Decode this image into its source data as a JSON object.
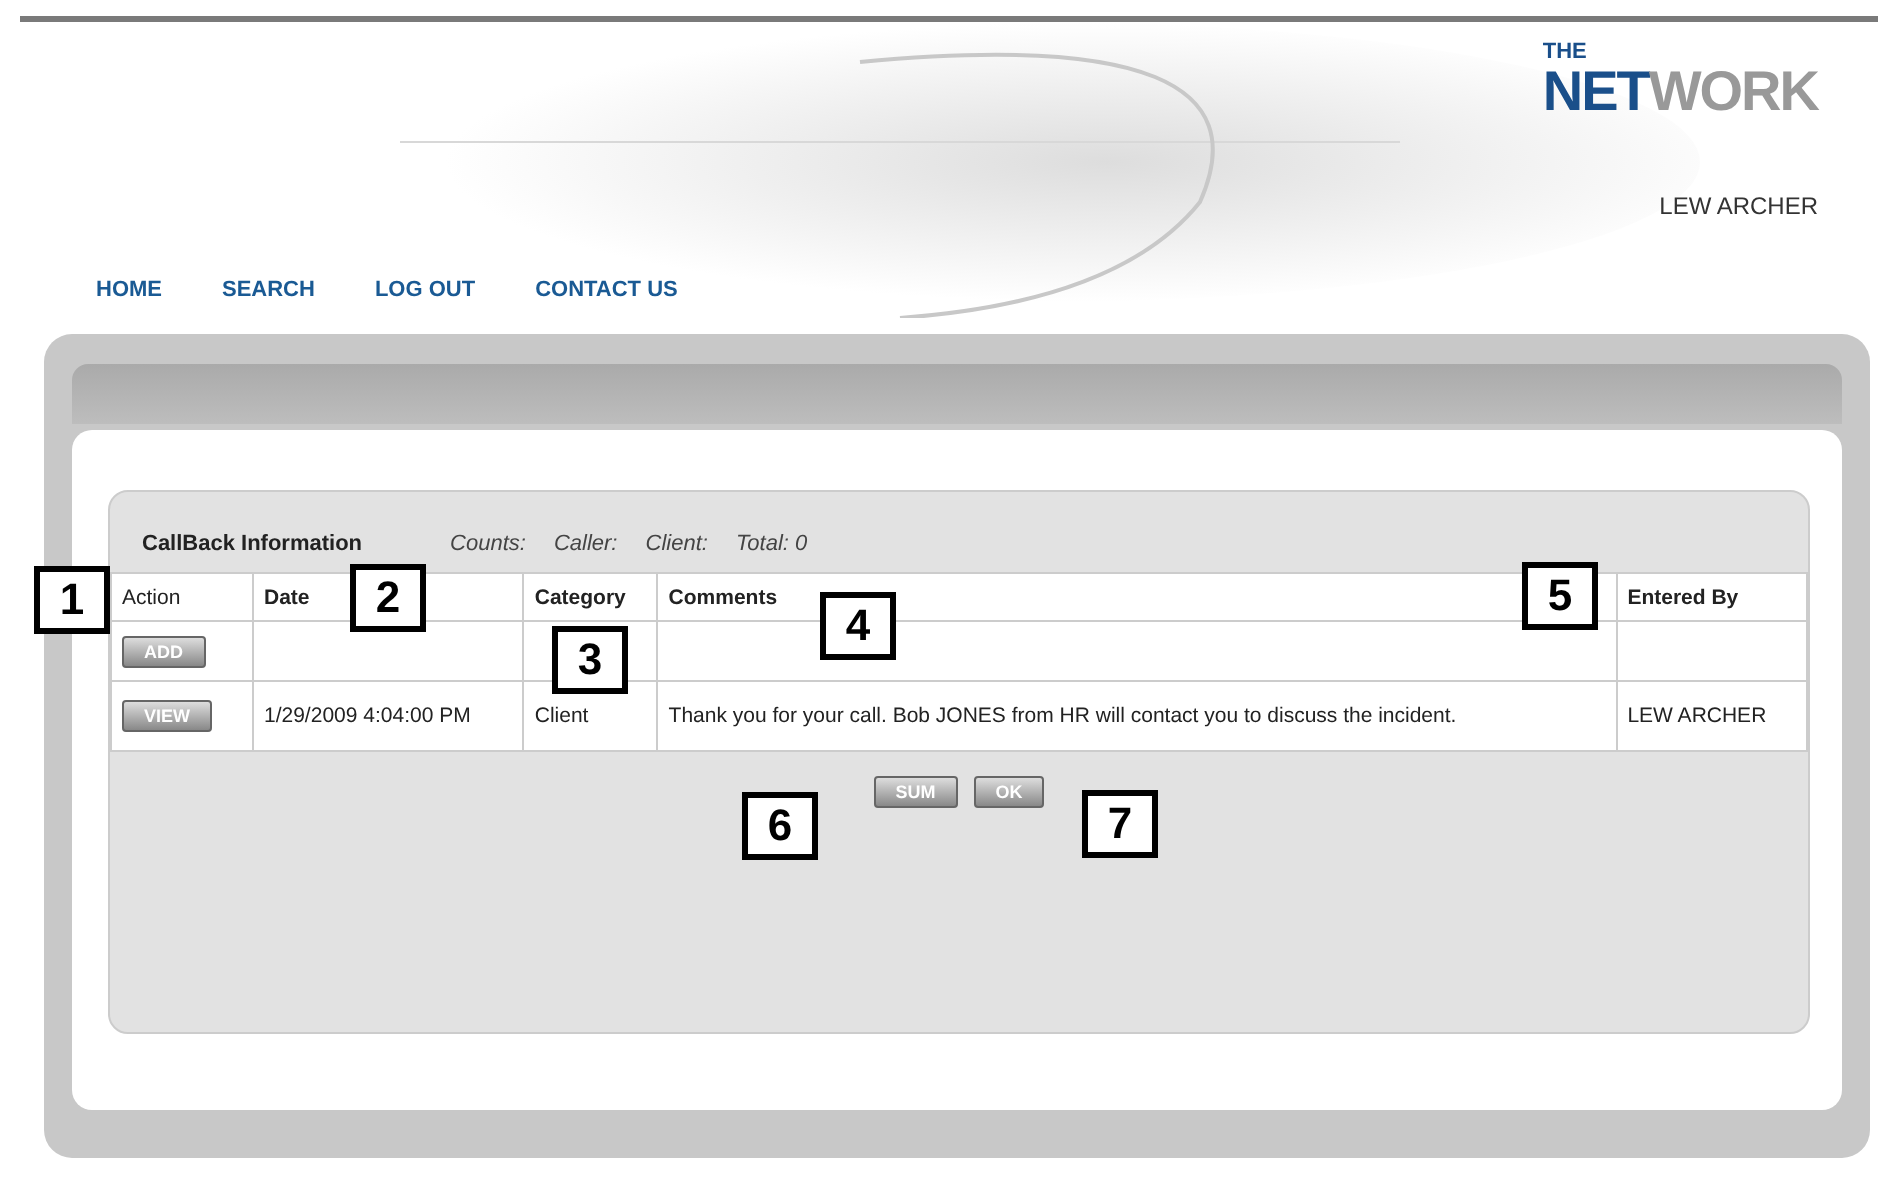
{
  "header": {
    "logo_top": "THE",
    "logo_main": "NET",
    "logo_accent": "WORK",
    "user": "LEW ARCHER"
  },
  "nav": [
    {
      "label": "HOME"
    },
    {
      "label": "SEARCH"
    },
    {
      "label": "LOG OUT"
    },
    {
      "label": "CONTACT US"
    }
  ],
  "panel": {
    "title": "CallBack Information",
    "counts": [
      "Counts:",
      "Caller:",
      "Client:",
      "Total: 0"
    ]
  },
  "table": {
    "columns": [
      {
        "label": "Action",
        "bold": false
      },
      {
        "label": "Date",
        "bold": true
      },
      {
        "label": "Category",
        "bold": true
      },
      {
        "label": "Comments",
        "bold": true
      },
      {
        "label": "Entered By",
        "bold": true
      }
    ],
    "rows": [
      {
        "cells": [
          "ADD",
          "",
          "",
          "",
          ""
        ]
      },
      {
        "cells": [
          "VIEW",
          "1/29/2009 4:04:00 PM",
          "Client",
          "Thank you for your call. Bob JONES from HR will contact you to discuss the incident.",
          "LEW ARCHER"
        ]
      }
    ]
  },
  "buttons": [
    "SUM",
    "OK"
  ],
  "callouts": [
    "1",
    "2",
    "3",
    "4",
    "5",
    "6",
    "7"
  ]
}
